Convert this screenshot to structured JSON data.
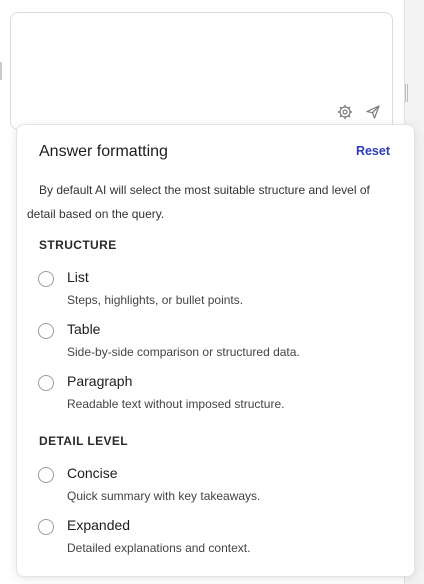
{
  "composer": {
    "placeholder": "",
    "settings_icon": "gear-icon",
    "send_icon": "send-icon"
  },
  "popover": {
    "title": "Answer formatting",
    "reset_label": "Reset",
    "description": "By default AI will select the most suitable structure and level of detail based on the query.",
    "structure_heading": "STRUCTURE",
    "structure_options": [
      {
        "label": "List",
        "description": "Steps, highlights, or bullet points.",
        "selected": false
      },
      {
        "label": "Table",
        "description": "Side-by-side comparison or structured data.",
        "selected": false
      },
      {
        "label": "Paragraph",
        "description": "Readable text without imposed structure.",
        "selected": false
      }
    ],
    "detail_heading": "DETAIL LEVEL",
    "detail_options": [
      {
        "label": "Concise",
        "description": "Quick summary with key takeaways.",
        "selected": false
      },
      {
        "label": "Expanded",
        "description": "Detailed explanations and context.",
        "selected": false
      }
    ]
  },
  "colors": {
    "accent": "#2e3bb8",
    "border": "#dcdce0",
    "text": "#1d1d1f"
  }
}
